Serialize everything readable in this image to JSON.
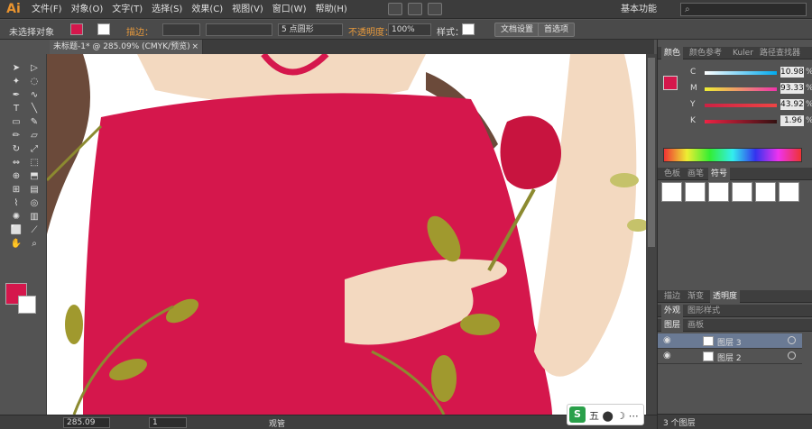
{
  "menubar": {
    "logo": "Ai",
    "items": [
      "文件(F)",
      "对象(O)",
      "文字(T)",
      "选择(S)",
      "效果(C)",
      "视图(V)",
      "窗口(W)",
      "帮助(H)"
    ],
    "workspace": "基本功能"
  },
  "control": {
    "selection": "未选择对象",
    "stroke_label": "描边：",
    "brush": "5 点圆形",
    "opacity_label": "不透明度：",
    "opacity": "100%",
    "style_label": "样式：",
    "doc_setup": "文档设置",
    "prefs": "首选项",
    "fill_color": "#d5174c"
  },
  "doc": {
    "tab": "未标题-1* @ 285.09% (CMYK/预览)",
    "close": "×"
  },
  "panel": {
    "color_tabs": [
      "颜色",
      "颜色参考",
      "Kuler",
      "路径查找器"
    ],
    "sliders": [
      {
        "l": "C",
        "v": "10.98",
        "c": "#c9255a"
      },
      {
        "l": "M",
        "v": "93.33",
        "c": "#e8e04a"
      },
      {
        "l": "Y",
        "v": "43.92",
        "c": "#e8304a"
      },
      {
        "l": "K",
        "v": "1.96",
        "c": "#d5174c"
      }
    ],
    "pct": "%",
    "swatch_tabs": [
      "色板",
      "画笔",
      "符号"
    ],
    "trans_tabs": [
      "描边",
      "渐变",
      "透明度"
    ],
    "appear_tabs": [
      "外观",
      "图形样式"
    ],
    "layer_tabs": [
      "图层",
      "画板"
    ],
    "layers": [
      "图层 3",
      "图层 2"
    ],
    "footer": "3 个图层"
  },
  "status": {
    "zoom": "285.09",
    "page": "1",
    "tool": "观管"
  },
  "ime": {
    "s": "S",
    "txt": "五 ⬤ ☽ ⋯"
  }
}
